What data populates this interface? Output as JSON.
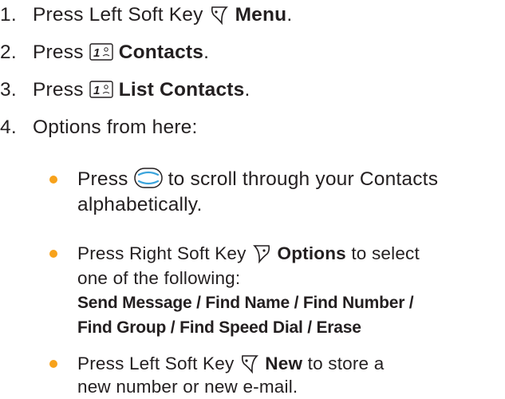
{
  "steps": [
    {
      "num": "1.",
      "pre": "Press Left Soft Key",
      "label": "Menu",
      "post": "."
    },
    {
      "num": "2.",
      "pre": "Press",
      "label": "Contacts",
      "post": "."
    },
    {
      "num": "3.",
      "pre": "Press",
      "label": "List Contacts",
      "post": "."
    },
    {
      "num": "4.",
      "text": "Options from here:"
    }
  ],
  "bullets": [
    {
      "pre": "Press",
      "line1_post": "to scroll through your Contacts",
      "line2": "alphabetically."
    },
    {
      "pre": "Press Right Soft Key",
      "label": "Options",
      "line1_post": "to select",
      "line2": "one of the following:",
      "menu_line1": [
        {
          "text": "Send Message",
          "sep": " / "
        },
        {
          "text": "Find Name",
          "sep": " / "
        },
        {
          "text": "Find Number",
          "sep": " /"
        }
      ],
      "menu_line2": [
        {
          "text": "Find Group",
          "sep": " / "
        },
        {
          "text": "Find Speed Dial",
          "sep": " / "
        },
        {
          "text": "Erase",
          "sep": ""
        }
      ]
    },
    {
      "pre": "Press Left Soft Key",
      "label": "New",
      "line1_post": "to store a",
      "line2": "new number or new e-mail."
    }
  ],
  "keys": {
    "one_key_digit": "1",
    "bullet_color": "#f7a21b",
    "icons": [
      "left-soft-key-icon",
      "key-1-icon",
      "nav-key-icon",
      "right-soft-key-icon"
    ]
  }
}
